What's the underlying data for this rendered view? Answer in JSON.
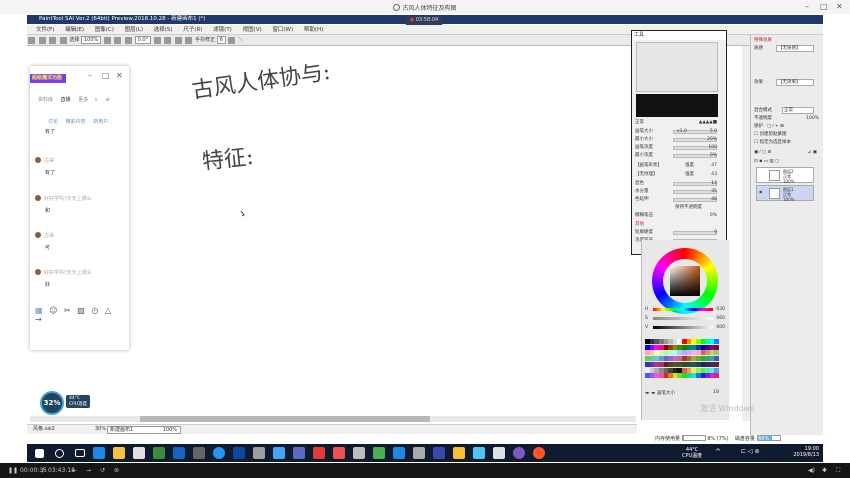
{
  "recorder": {
    "window_title": "古风人体特征及构图",
    "timer": "03:58:04",
    "elapsed": "00:00:35",
    "total": "03:43:18",
    "sep": "/"
  },
  "sai": {
    "title": "PaintTool SAI Ver.2 (64bit) Preview.2018.10.28 - 新建画布1 (*)",
    "menu": [
      "文件(F)",
      "编辑(E)",
      "图像(C)",
      "图层(L)",
      "选择(S)",
      "尺子(R)",
      "滤镜(T)",
      "视图(V)",
      "窗口(W)",
      "帮助(H)"
    ],
    "toolbar": {
      "select_label": "选择",
      "zoom": "100%",
      "angle": "0.0°",
      "stabilizer_label": "手抖修正",
      "stabilizer_value": "6"
    },
    "canvas_tabs": [
      {
        "name": "风格.sai2",
        "zoom": "30%"
      },
      {
        "name": "新建画布1",
        "zoom": "100%"
      }
    ]
  },
  "tool_window": {
    "title": "工具",
    "mode": "正常",
    "rows": [
      {
        "label": "画笔大小",
        "value": "5.0",
        "prefix": "x1.0"
      },
      {
        "label": "最小大小",
        "value": "20%"
      },
      {
        "label": "画笔浓度",
        "value": "100"
      },
      {
        "label": "最小浓度",
        "value": "0%"
      }
    ],
    "sections": [
      {
        "label": "【画笔形状】",
        "extra": "强度",
        "value": "47"
      },
      {
        "label": "【无纹理】",
        "extra": "强度",
        "value": "43"
      },
      {
        "label": "混色",
        "value": "14"
      },
      {
        "label": "水分量",
        "value": "35"
      },
      {
        "label": "色延伸",
        "value": "48"
      }
    ],
    "keep_opacity": "保持不透明度",
    "blur_pressure_label": "模糊笔压",
    "blur_pressure_value": "0%",
    "other_label": "其他",
    "edge_hardness_label": "轮廓硬度",
    "edge_hardness_value": "9",
    "pressure_label": "浓度笔压",
    "version_button": "Ver.1笔压特性"
  },
  "color": {
    "h": {
      "label": "H",
      "value": "030"
    },
    "s": {
      "label": "S",
      "value": "060"
    },
    "v": {
      "label": "V",
      "value": "000"
    },
    "zoom_label": "画笔大小",
    "zoom_value": "18"
  },
  "layers": {
    "header": "特殊效果",
    "texture_label": "质感",
    "texture_value": "【无质感】",
    "effect_label": "效果",
    "effect_value": "【无效果】",
    "blend_label": "混合模式",
    "blend_value": "正常",
    "opacity_label": "不透明度",
    "opacity_value": "100%",
    "protect_label": "保护",
    "clip_label": "创建剪贴蒙版",
    "ref_label": "指定为选区样本",
    "items": [
      {
        "name": "图层2",
        "mode": "正常",
        "opacity": "100%"
      },
      {
        "name": "图层1",
        "mode": "正常",
        "opacity": "100%"
      }
    ],
    "memory_label": "内存使用量",
    "memory_value": "8% (7%)",
    "disk_label": "磁盘容量",
    "disk_value": "66%"
  },
  "chat": {
    "badge": "超级魔法功能",
    "tabs": [
      "资料库",
      "直播",
      "更多"
    ],
    "sub_tabs": [
      "讨论",
      "精彩内容",
      "新用户"
    ],
    "messages": [
      {
        "name": "",
        "text": "有了"
      },
      {
        "name": "古得",
        "text": "有了"
      },
      {
        "name": "好好学吗?天天上课么",
        "text": "和"
      },
      {
        "name": "古得",
        "text": "可"
      },
      {
        "name": "好好学吗?天天上课么",
        "text": "好"
      }
    ]
  },
  "canvas_text": {
    "line1": "古风人体协与:",
    "line2": "特征:"
  },
  "cpu": {
    "percent": "32%",
    "temp": "44°C",
    "label": "CPU温度"
  },
  "watermark": "激活 Windows",
  "taskbar": {
    "tray_temp": "44°C",
    "tray_cpu_label": "CPU温度",
    "time": "19:00",
    "date": "2019/8/13"
  },
  "colors": {
    "accent": "#3ca3e0",
    "title_bar": "#1f3a6a",
    "taskbar": "#0f1a2e",
    "badge": "#7b3ff0"
  }
}
